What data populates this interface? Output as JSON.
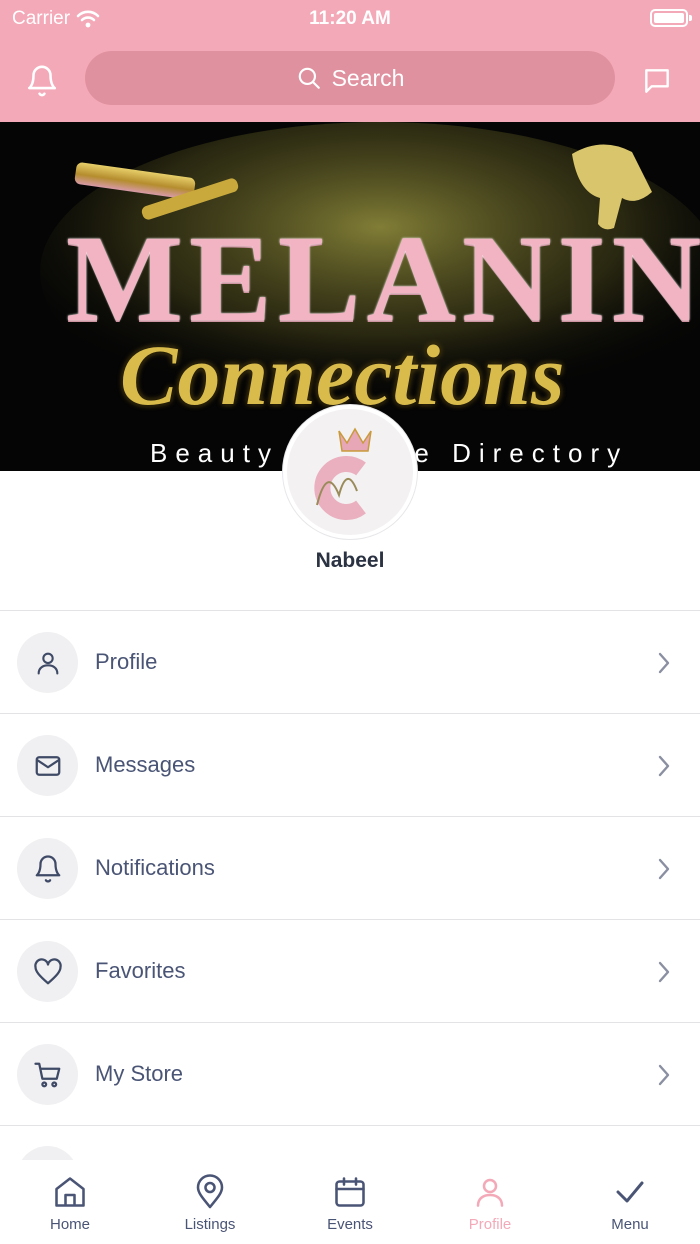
{
  "status_bar": {
    "carrier": "Carrier",
    "time": "11:20 AM"
  },
  "header": {
    "search_placeholder": "Search"
  },
  "banner": {
    "title_line1": "MELANIN",
    "title_line2": "Connections",
    "tagline": "Beauty Service Directory"
  },
  "profile": {
    "name": "Nabeel"
  },
  "menu": [
    {
      "label": "Profile",
      "icon": "user-icon"
    },
    {
      "label": "Messages",
      "icon": "mail-icon"
    },
    {
      "label": "Notifications",
      "icon": "bell-icon"
    },
    {
      "label": "Favorites",
      "icon": "heart-icon"
    },
    {
      "label": "My Store",
      "icon": "cart-icon"
    }
  ],
  "tabs": [
    {
      "label": "Home",
      "icon": "home-icon"
    },
    {
      "label": "Listings",
      "icon": "map-pin-icon"
    },
    {
      "label": "Events",
      "icon": "calendar-icon"
    },
    {
      "label": "Profile",
      "icon": "user-icon",
      "active": true
    },
    {
      "label": "Menu",
      "icon": "checkmark-icon"
    }
  ],
  "colors": {
    "accent": "#f4a9b8",
    "search_bg": "#e0919f",
    "text": "#4a5576",
    "gold": "#c9a93c"
  }
}
